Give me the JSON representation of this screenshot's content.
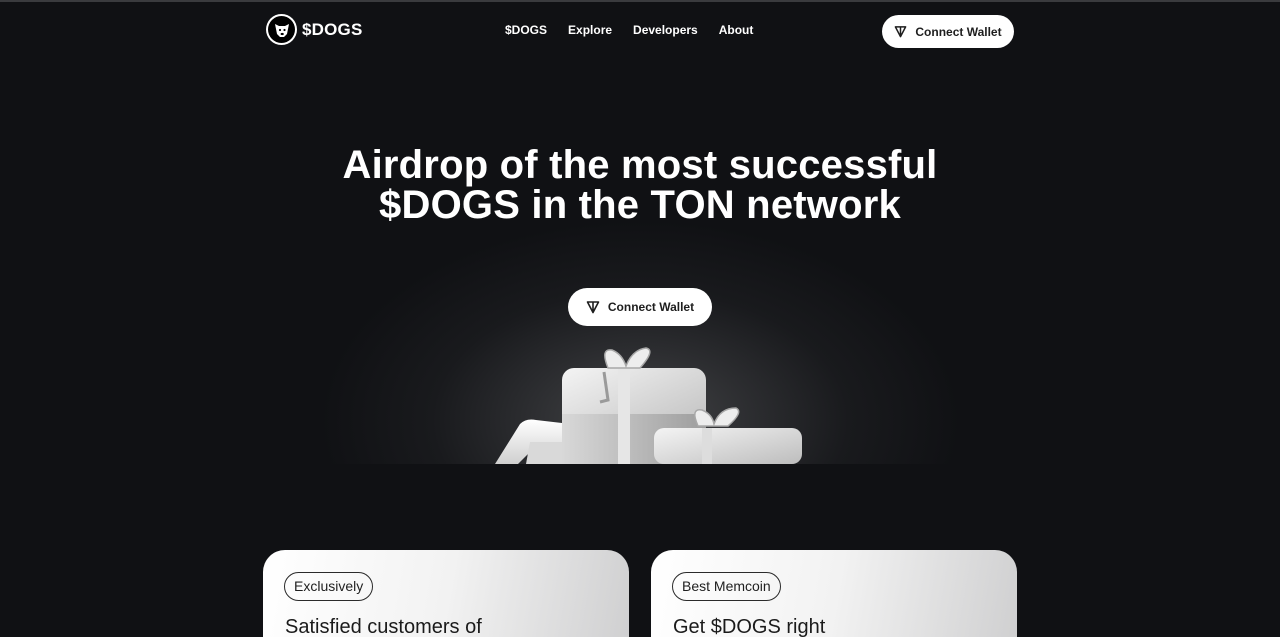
{
  "header": {
    "logo_text": "$DOGS",
    "nav": [
      "$DOGS",
      "Explore",
      "Developers",
      "About"
    ],
    "connect_label": "Connect Wallet"
  },
  "hero": {
    "title": "Airdrop of the most successful $DOGS in the TON network",
    "connect_label": "Connect Wallet"
  },
  "cards": [
    {
      "tag": "Exclusively",
      "title": "Satisfied customers of"
    },
    {
      "tag": "Best Memcoin",
      "title": "Get $DOGS right"
    }
  ],
  "icons": {
    "logo": "dog-head-icon",
    "wallet": "ton-logo-icon"
  },
  "colors": {
    "background": "#101114",
    "button_bg": "#ffffff",
    "button_text": "#1e1e1e"
  }
}
